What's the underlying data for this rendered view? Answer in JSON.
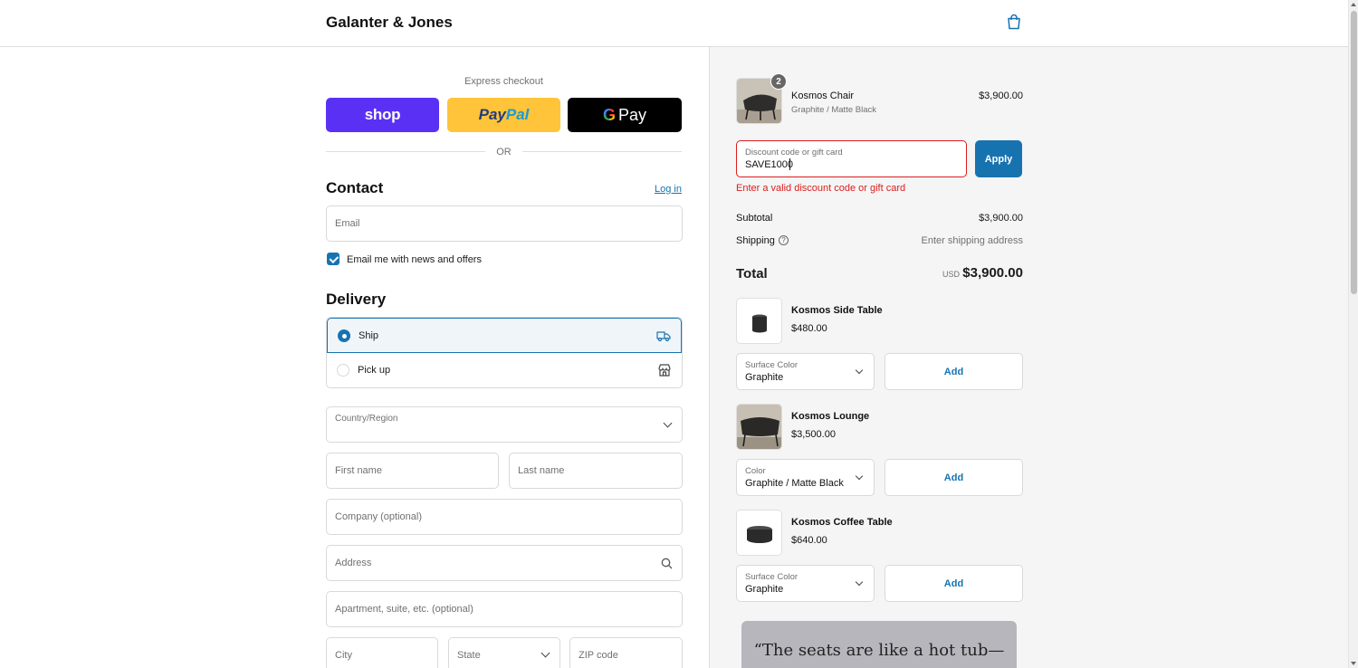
{
  "header": {
    "brand": "Galanter & Jones",
    "cart_icon": "shopping-bag-icon"
  },
  "express": {
    "label": "Express checkout",
    "shop_pay": "shop",
    "paypal_a": "Pay",
    "paypal_b": "Pal",
    "gpay_g": "G",
    "gpay_text": "Pay",
    "or": "OR"
  },
  "contact": {
    "title": "Contact",
    "login": "Log in",
    "email_placeholder": "Email",
    "newsletter_label": "Email me with news and offers",
    "newsletter_checked": true
  },
  "delivery": {
    "title": "Delivery",
    "options": [
      {
        "label": "Ship",
        "selected": true,
        "icon": "truck-icon"
      },
      {
        "label": "Pick up",
        "selected": false,
        "icon": "store-icon"
      }
    ],
    "country_label": "Country/Region",
    "first_name": "First name",
    "last_name": "Last name",
    "company": "Company (optional)",
    "address": "Address",
    "apartment": "Apartment, suite, etc. (optional)",
    "city": "City",
    "state": "State",
    "zip": "ZIP code"
  },
  "order": {
    "item": {
      "name": "Kosmos Chair",
      "variant": "Graphite / Matte Black",
      "price": "$3,900.00",
      "quantity": "2"
    },
    "discount": {
      "label": "Discount code or gift card",
      "value": "SAVE1000",
      "apply": "Apply",
      "error": "Enter a valid discount code or gift card"
    },
    "subtotal_label": "Subtotal",
    "subtotal_value": "$3,900.00",
    "shipping_label": "Shipping",
    "shipping_value": "Enter shipping address",
    "total_label": "Total",
    "total_currency": "USD",
    "total_value": "$3,900.00"
  },
  "upsells": [
    {
      "name": "Kosmos Side Table",
      "price": "$480.00",
      "option_label": "Surface Color",
      "option_value": "Graphite",
      "add": "Add"
    },
    {
      "name": "Kosmos Lounge",
      "price": "$3,500.00",
      "option_label": "Color",
      "option_value": "Graphite / Matte Black",
      "add": "Add"
    },
    {
      "name": "Kosmos Coffee Table",
      "price": "$640.00",
      "option_label": "Surface Color",
      "option_value": "Graphite",
      "add": "Add"
    }
  ],
  "quote": {
    "text": "“The seats are like a hot tub—"
  },
  "colors": {
    "accent": "#1773b0",
    "error": "#dd1d1d",
    "shop_pay": "#5a31f4",
    "paypal": "#ffc439"
  }
}
